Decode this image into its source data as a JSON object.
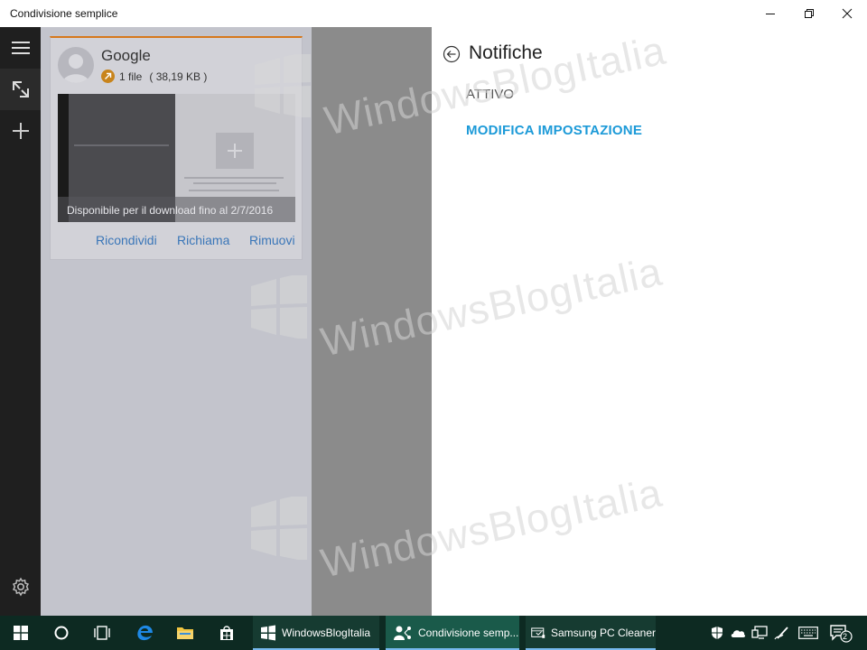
{
  "window": {
    "title": "Condivisione semplice"
  },
  "card": {
    "name": "Google",
    "file_count": "1 file",
    "file_size": "( 38,19 KB )",
    "preview_caption": "Disponibile per il download fino al 2/7/2016",
    "actions": [
      "Ricondividi",
      "Richiama",
      "Rimuovi"
    ]
  },
  "panel": {
    "title": "Notifiche",
    "status": "ATTIVO",
    "settings_link": "MODIFICA IMPOSTAZIONE"
  },
  "watermark": {
    "text": "WindowsBlogItalia"
  },
  "taskbar": {
    "apps": [
      {
        "label": "WindowsBlogItalia",
        "icon": "windowsblogitalia-icon"
      },
      {
        "label": "Condivisione semp...",
        "icon": "share-app-icon"
      },
      {
        "label": "Samsung PC Cleaner",
        "icon": "samsung-cleaner-icon"
      }
    ],
    "notification_count": "2"
  },
  "colors": {
    "accent_link": "#1c9ad8",
    "card_action": "#3a76b8",
    "card_border": "#d6781c",
    "taskbar": "#0d2a22",
    "nav": "#1f1f1f"
  }
}
